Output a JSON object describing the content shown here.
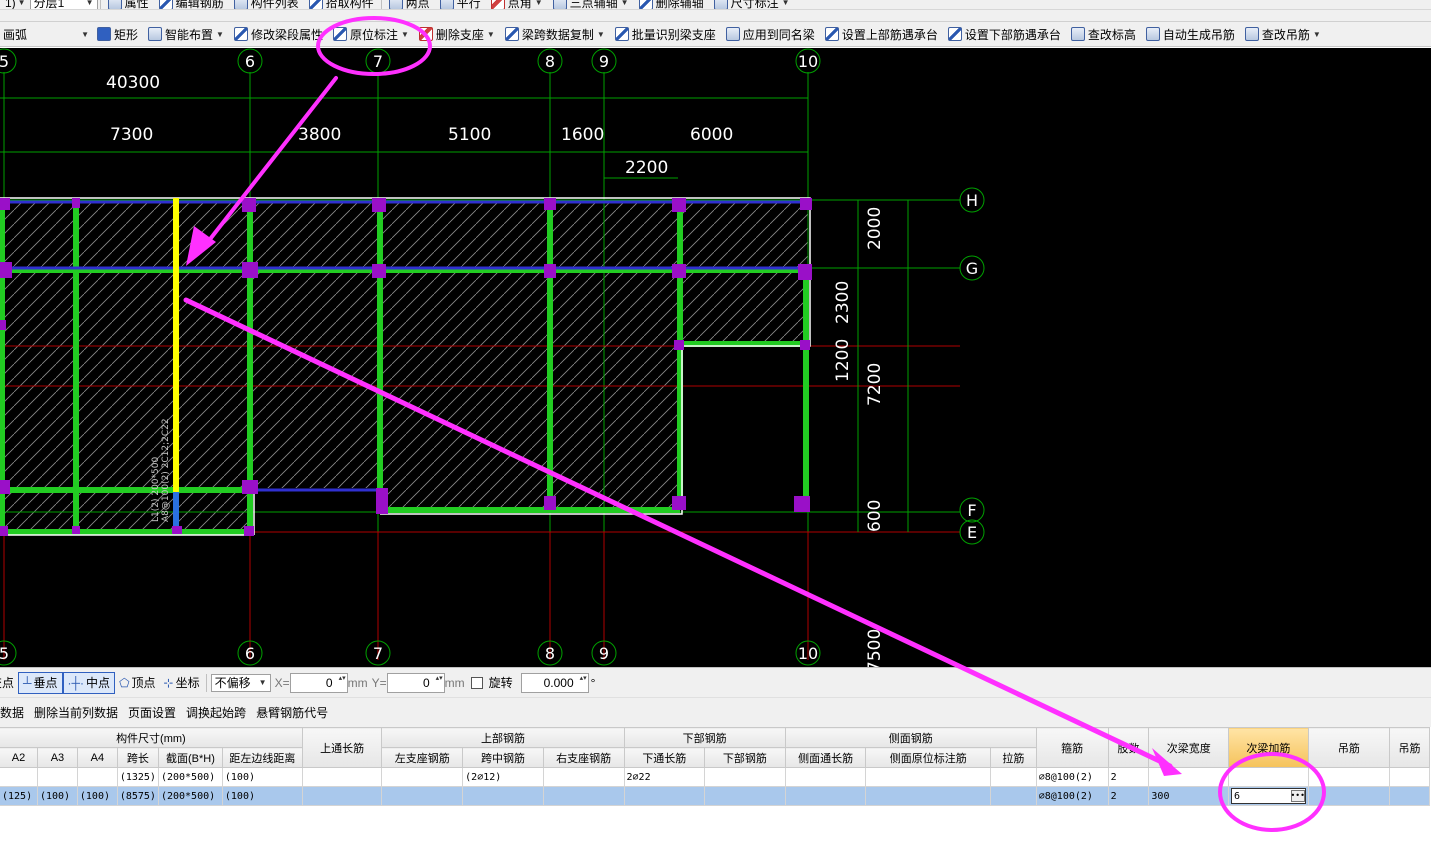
{
  "toolbar1": {
    "floor_prefix": "1)",
    "floor_label": "分层1",
    "items": [
      "属性",
      "编辑钢筋",
      "构件列表",
      "拾取构件",
      "两点",
      "平行",
      "点角",
      "三点辅轴",
      "删除辅轴",
      "尺寸标注"
    ]
  },
  "toolbar2": {
    "draw_mode": "画弧",
    "items": [
      "矩形",
      "智能布置",
      "修改梁段属性",
      "原位标注",
      "删除支座",
      "梁跨数据复制",
      "批量识别梁支座",
      "应用到同名梁",
      "设置上部筋遇承台",
      "设置下部筋遇承台",
      "查改标高",
      "自动生成吊筋",
      "查改吊筋"
    ]
  },
  "drawing": {
    "axis_top": [
      "5",
      "6",
      "7",
      "8",
      "9",
      "10"
    ],
    "axis_bottom": [
      "5",
      "6",
      "7",
      "8",
      "9",
      "10"
    ],
    "axis_right": [
      "H",
      "G",
      "F",
      "E"
    ],
    "dims_total": "40300",
    "dims_row2": [
      "7300",
      "3800",
      "5100",
      "1600",
      "6000"
    ],
    "dim_2200": "2200",
    "dims_vertical": [
      "2000",
      "2300",
      "1200",
      "7200",
      "600",
      "7500"
    ],
    "beam_annotation_1": "L1(2) 200*500",
    "beam_annotation_2": "A8@100(2) 2C12;2C22"
  },
  "snapbar": {
    "items": [
      "交点",
      "垂点",
      "中点",
      "顶点",
      "坐标"
    ],
    "offset_mode": "不偏移",
    "x_label": "X=",
    "x_value": "0",
    "y_label": "Y=",
    "y_value": "0",
    "unit": "mm",
    "rotate_label": "旋转",
    "rotate_value": "0.000",
    "degree": "°"
  },
  "actionbar": {
    "items": [
      "数据",
      "删除当前列数据",
      "页面设置",
      "调换起始跨",
      "悬臂钢筋代号"
    ]
  },
  "grid": {
    "group_headers": [
      "构件尺寸(mm)",
      "上通长筋",
      "上部钢筋",
      "下部钢筋",
      "侧面钢筋",
      "箍筋",
      "肢数",
      "次梁宽度",
      "次梁加筋",
      "吊筋",
      "吊筋"
    ],
    "sub_headers": [
      "A2",
      "A3",
      "A4",
      "跨长",
      "截面(B*H)",
      "距左边线距离",
      "左支座钢筋",
      "跨中钢筋",
      "右支座钢筋",
      "下通长筋",
      "下部钢筋",
      "侧面通长筋",
      "侧面原位标注筋",
      "拉筋"
    ],
    "rows": [
      [
        "",
        "",
        "",
        "(1325)",
        "(200*500)",
        "(100)",
        "",
        "",
        "(2⌀12)",
        "",
        "2⌀22",
        "",
        "",
        "",
        "",
        "⌀8@100(2)",
        "2",
        "",
        "",
        "",
        ""
      ],
      [
        "(125)",
        "(100)",
        "(100)",
        "(8575)",
        "(200*500)",
        "(100)",
        "",
        "",
        "",
        "",
        "",
        "",
        "",
        "",
        "",
        "⌀8@100(2)",
        "2",
        "300",
        "6",
        "",
        ""
      ]
    ]
  },
  "colors": {
    "beam": "#22cc22",
    "column": "#9a10c8",
    "selected_beam": "#ffff00",
    "axis_line": "#00a000",
    "grid_red": "#b00000",
    "annotation": "#ff30ff"
  }
}
